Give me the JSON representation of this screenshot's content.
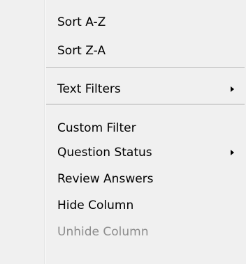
{
  "menu": {
    "items": [
      {
        "label": "Sort A-Z"
      },
      {
        "label": "Sort Z-A"
      },
      {
        "label": "Text Filters",
        "submenu": true
      },
      {
        "label": "Custom Filter"
      },
      {
        "label": "Question Status",
        "submenu": true
      },
      {
        "label": "Review Answers"
      },
      {
        "label": "Hide Column"
      },
      {
        "label": "Unhide Column",
        "disabled": true
      }
    ],
    "icons": {
      "submenu_arrow": "chevron-right-icon"
    },
    "colors": {
      "background": "#f0f0f0",
      "text": "#000000",
      "disabled_text": "#8d8d8d",
      "separator": "#a0a0a0"
    }
  }
}
